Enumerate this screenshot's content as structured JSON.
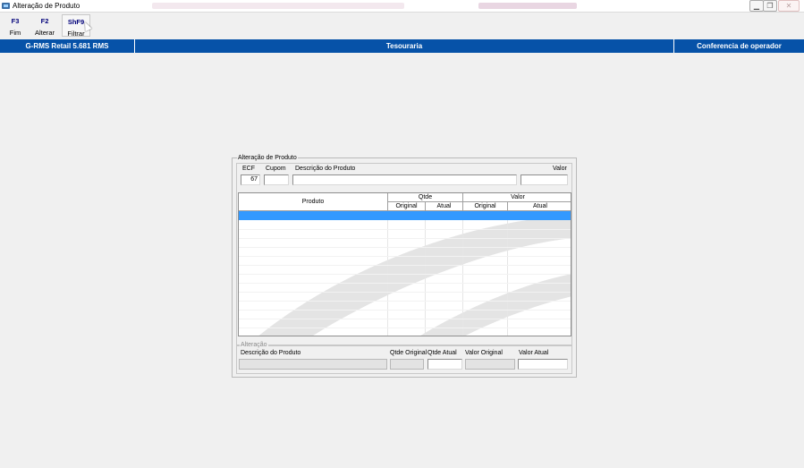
{
  "window": {
    "title": "Alteração de Produto"
  },
  "toolbar": {
    "items": [
      {
        "key": "F3",
        "label": "Fim"
      },
      {
        "key": "F2",
        "label": "Alterar"
      },
      {
        "key": "ShF9",
        "label": "Filtrar"
      }
    ]
  },
  "statusbar": {
    "left": "G-RMS Retail 5.681 RMS",
    "center": "Tesouraria",
    "right": "Conferencia de operador"
  },
  "dialog": {
    "group_title": "Alteração de Produto",
    "labels": {
      "ecf": "ECF",
      "cupom": "Cupom",
      "descricao": "Descrição do Produto",
      "valor": "Valor"
    },
    "values": {
      "ecf": "67",
      "cupom": "",
      "descricao": "",
      "valor": ""
    },
    "grid": {
      "col_produto": "Produto",
      "col_qtde": "Qtde",
      "col_valor": "Valor",
      "sub_original": "Original",
      "sub_atual": "Atual"
    },
    "alteracao": {
      "group_title": "Alteração",
      "labels": {
        "descricao": "Descrição do Produto",
        "qtde_original": "Qtde Original",
        "qtde_atual": "Qtde Atual",
        "valor_original": "Valor Original",
        "valor_atual": "Valor Atual"
      }
    }
  },
  "colors": {
    "statusbar_bg": "#0652a8",
    "selection": "#3399ff",
    "toolbar_key": "#00007a"
  }
}
